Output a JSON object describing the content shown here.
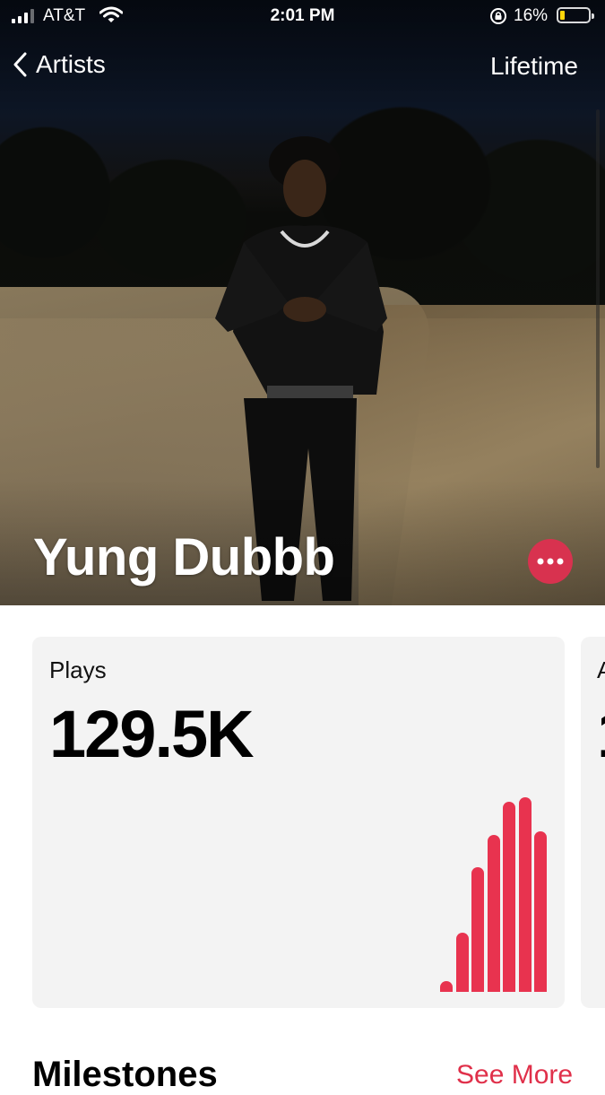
{
  "status_bar": {
    "carrier": "AT&T",
    "time": "2:01 PM",
    "battery": "16%",
    "battery_level": 0.16
  },
  "nav": {
    "back_label": "Artists",
    "period_label": "Lifetime"
  },
  "artist": {
    "name": "Yung Dubbb"
  },
  "stats": {
    "plays": {
      "label": "Plays",
      "value": "129.5K"
    },
    "next_card_peek": {
      "label": "A",
      "value": "1"
    }
  },
  "milestones": {
    "title": "Milestones",
    "see_more_label": "See More"
  },
  "colors": {
    "accent": "#e8334f",
    "card_bg": "#f3f3f3"
  },
  "chart_data": {
    "type": "bar",
    "title": "",
    "relative_values": [
      0.05,
      0.28,
      0.59,
      0.74,
      0.9,
      0.92,
      0.76
    ],
    "ylim": [
      0,
      1
    ]
  }
}
